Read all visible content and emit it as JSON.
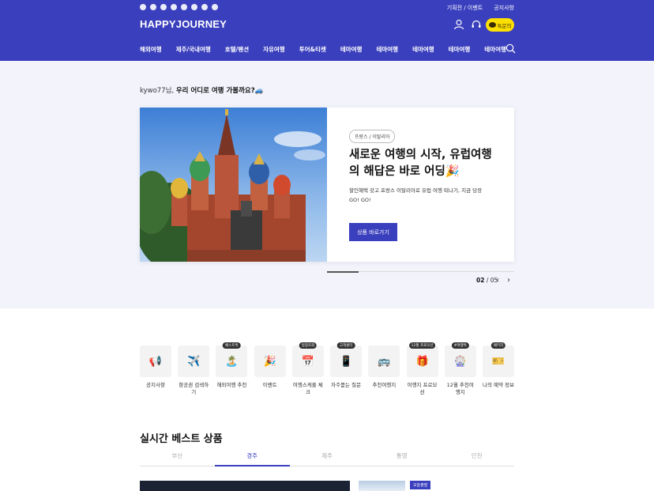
{
  "header": {
    "brand": "HAPPYJOURNEY",
    "links": [
      "기획전 / 이벤트",
      "공지사항"
    ],
    "talk_label": "톡문의",
    "social_icons": [
      "instagram-icon",
      "facebook-icon",
      "youtube-icon",
      "kakao-story-icon",
      "naver-tv-icon",
      "blog-icon",
      "tiktok-icon",
      "band-icon"
    ],
    "nav": [
      "해외여행",
      "제주/국내여행",
      "호텔/펜션",
      "자유여행",
      "투어&티켓",
      "테마여행",
      "테마여행",
      "테마여행",
      "테마여행",
      "테마여행"
    ]
  },
  "hero": {
    "greeting_user": "kywo77님,",
    "greeting_text": "우리 어디로 여행 가볼까요?🚙",
    "tag": "프랑스 / 이탈리아",
    "title": "새로운 여행의 시작, 유럽여행의 해답은 바로 어딩🎉",
    "desc": "할인혜택 갖고 프랑스 이탈리아로 유럽 여행 떠나기, 지금 당장 GO! GO!",
    "button": "상품 바로가기",
    "page_current": "02",
    "page_total": "/ 05",
    "progress": 0.167
  },
  "quick_menu": [
    {
      "icon": "📢",
      "label": "공지사항",
      "badge": ""
    },
    {
      "icon": "✈️",
      "label": "항공권 검색하기",
      "badge": ""
    },
    {
      "icon": "🏝️",
      "label": "해외여행 추천",
      "badge": "베스트특"
    },
    {
      "icon": "🎉",
      "label": "이벤트",
      "badge": ""
    },
    {
      "icon": "📅",
      "label": "여행스케줄 체크",
      "badge": "일정조회"
    },
    {
      "icon": "📱",
      "label": "자주묻는 질문",
      "badge": "고객센터"
    },
    {
      "icon": "🚌",
      "label": "추천여행지",
      "badge": ""
    },
    {
      "icon": "🎁",
      "label": "여행지 프로모션",
      "badge": "12월 프로모션"
    },
    {
      "icon": "🎡",
      "label": "12월 추천여행지",
      "badge": "#여행특"
    },
    {
      "icon": "🎫",
      "label": "나의 예약 정보",
      "badge": "패키지"
    }
  ],
  "best": {
    "title": "실시간 베스트 상품",
    "tabs": [
      "부산",
      "경주",
      "제주",
      "통영",
      "인천"
    ],
    "active_tab": 1,
    "badge": "오늘출발"
  }
}
